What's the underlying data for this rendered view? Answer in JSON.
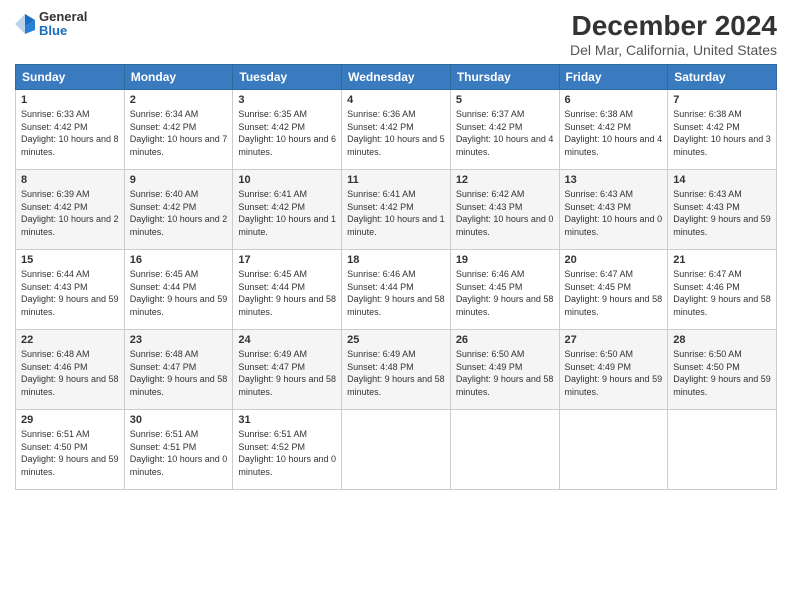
{
  "header": {
    "logo": {
      "general": "General",
      "blue": "Blue"
    },
    "title": "December 2024",
    "subtitle": "Del Mar, California, United States"
  },
  "weekdays": [
    "Sunday",
    "Monday",
    "Tuesday",
    "Wednesday",
    "Thursday",
    "Friday",
    "Saturday"
  ],
  "weeks": [
    [
      {
        "day": "1",
        "sunrise": "6:33 AM",
        "sunset": "4:42 PM",
        "daylight": "10 hours and 8 minutes."
      },
      {
        "day": "2",
        "sunrise": "6:34 AM",
        "sunset": "4:42 PM",
        "daylight": "10 hours and 7 minutes."
      },
      {
        "day": "3",
        "sunrise": "6:35 AM",
        "sunset": "4:42 PM",
        "daylight": "10 hours and 6 minutes."
      },
      {
        "day": "4",
        "sunrise": "6:36 AM",
        "sunset": "4:42 PM",
        "daylight": "10 hours and 5 minutes."
      },
      {
        "day": "5",
        "sunrise": "6:37 AM",
        "sunset": "4:42 PM",
        "daylight": "10 hours and 4 minutes."
      },
      {
        "day": "6",
        "sunrise": "6:38 AM",
        "sunset": "4:42 PM",
        "daylight": "10 hours and 4 minutes."
      },
      {
        "day": "7",
        "sunrise": "6:38 AM",
        "sunset": "4:42 PM",
        "daylight": "10 hours and 3 minutes."
      }
    ],
    [
      {
        "day": "8",
        "sunrise": "6:39 AM",
        "sunset": "4:42 PM",
        "daylight": "10 hours and 2 minutes."
      },
      {
        "day": "9",
        "sunrise": "6:40 AM",
        "sunset": "4:42 PM",
        "daylight": "10 hours and 2 minutes."
      },
      {
        "day": "10",
        "sunrise": "6:41 AM",
        "sunset": "4:42 PM",
        "daylight": "10 hours and 1 minute."
      },
      {
        "day": "11",
        "sunrise": "6:41 AM",
        "sunset": "4:42 PM",
        "daylight": "10 hours and 1 minute."
      },
      {
        "day": "12",
        "sunrise": "6:42 AM",
        "sunset": "4:43 PM",
        "daylight": "10 hours and 0 minutes."
      },
      {
        "day": "13",
        "sunrise": "6:43 AM",
        "sunset": "4:43 PM",
        "daylight": "10 hours and 0 minutes."
      },
      {
        "day": "14",
        "sunrise": "6:43 AM",
        "sunset": "4:43 PM",
        "daylight": "9 hours and 59 minutes."
      }
    ],
    [
      {
        "day": "15",
        "sunrise": "6:44 AM",
        "sunset": "4:43 PM",
        "daylight": "9 hours and 59 minutes."
      },
      {
        "day": "16",
        "sunrise": "6:45 AM",
        "sunset": "4:44 PM",
        "daylight": "9 hours and 59 minutes."
      },
      {
        "day": "17",
        "sunrise": "6:45 AM",
        "sunset": "4:44 PM",
        "daylight": "9 hours and 58 minutes."
      },
      {
        "day": "18",
        "sunrise": "6:46 AM",
        "sunset": "4:44 PM",
        "daylight": "9 hours and 58 minutes."
      },
      {
        "day": "19",
        "sunrise": "6:46 AM",
        "sunset": "4:45 PM",
        "daylight": "9 hours and 58 minutes."
      },
      {
        "day": "20",
        "sunrise": "6:47 AM",
        "sunset": "4:45 PM",
        "daylight": "9 hours and 58 minutes."
      },
      {
        "day": "21",
        "sunrise": "6:47 AM",
        "sunset": "4:46 PM",
        "daylight": "9 hours and 58 minutes."
      }
    ],
    [
      {
        "day": "22",
        "sunrise": "6:48 AM",
        "sunset": "4:46 PM",
        "daylight": "9 hours and 58 minutes."
      },
      {
        "day": "23",
        "sunrise": "6:48 AM",
        "sunset": "4:47 PM",
        "daylight": "9 hours and 58 minutes."
      },
      {
        "day": "24",
        "sunrise": "6:49 AM",
        "sunset": "4:47 PM",
        "daylight": "9 hours and 58 minutes."
      },
      {
        "day": "25",
        "sunrise": "6:49 AM",
        "sunset": "4:48 PM",
        "daylight": "9 hours and 58 minutes."
      },
      {
        "day": "26",
        "sunrise": "6:50 AM",
        "sunset": "4:49 PM",
        "daylight": "9 hours and 58 minutes."
      },
      {
        "day": "27",
        "sunrise": "6:50 AM",
        "sunset": "4:49 PM",
        "daylight": "9 hours and 59 minutes."
      },
      {
        "day": "28",
        "sunrise": "6:50 AM",
        "sunset": "4:50 PM",
        "daylight": "9 hours and 59 minutes."
      }
    ],
    [
      {
        "day": "29",
        "sunrise": "6:51 AM",
        "sunset": "4:50 PM",
        "daylight": "9 hours and 59 minutes."
      },
      {
        "day": "30",
        "sunrise": "6:51 AM",
        "sunset": "4:51 PM",
        "daylight": "10 hours and 0 minutes."
      },
      {
        "day": "31",
        "sunrise": "6:51 AM",
        "sunset": "4:52 PM",
        "daylight": "10 hours and 0 minutes."
      },
      null,
      null,
      null,
      null
    ]
  ],
  "labels": {
    "sunrise": "Sunrise:",
    "sunset": "Sunset:",
    "daylight": "Daylight:"
  }
}
